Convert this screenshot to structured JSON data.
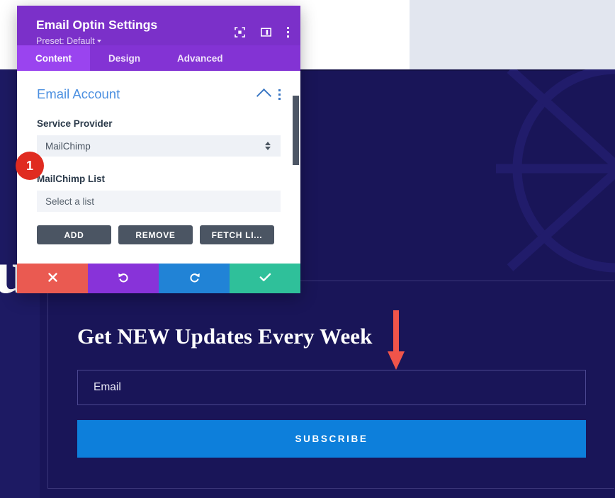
{
  "modal": {
    "title": "Email Optin Settings",
    "preset_label": "Preset: Default",
    "header_icons": [
      {
        "name": "focus-icon",
        "label": "Focus"
      },
      {
        "name": "layout-split-icon",
        "label": "Layout"
      },
      {
        "name": "more-options-icon",
        "label": "More options"
      }
    ],
    "tabs": [
      {
        "label": "Content",
        "active": true
      },
      {
        "label": "Design",
        "active": false
      },
      {
        "label": "Advanced",
        "active": false
      }
    ],
    "section": {
      "title": "Email Account",
      "collapse_icon": "chevron-up-icon",
      "menu_icon": "more-options-icon"
    },
    "fields": {
      "service_provider_label": "Service Provider",
      "service_provider_value": "MailChimp",
      "list_label": "MailChimp List",
      "list_placeholder": "Select a list"
    },
    "buttons": {
      "add": "ADD",
      "remove": "REMOVE",
      "fetch": "FETCH LI..."
    },
    "footer": [
      {
        "name": "cancel-button",
        "icon": "close-icon",
        "color": "#ea5a51"
      },
      {
        "name": "undo-button",
        "icon": "undo-icon",
        "color": "#8833d9"
      },
      {
        "name": "redo-button",
        "icon": "redo-icon",
        "color": "#2183d6"
      },
      {
        "name": "save-button",
        "icon": "check-icon",
        "color": "#2fc09a"
      }
    ]
  },
  "annotations": {
    "step_badge": "1",
    "arrow_color": "#f0544a"
  },
  "page": {
    "background_letter": "u",
    "optin": {
      "heading": "Get NEW Updates Every Week",
      "email_value": "Email",
      "subscribe_label": "SUBSCRIBE"
    },
    "colors": {
      "navy": "#191558",
      "accent_blue": "#0d7fdb",
      "modal_purple": "#7b30c9",
      "tab_active": "#9a44ef"
    }
  }
}
